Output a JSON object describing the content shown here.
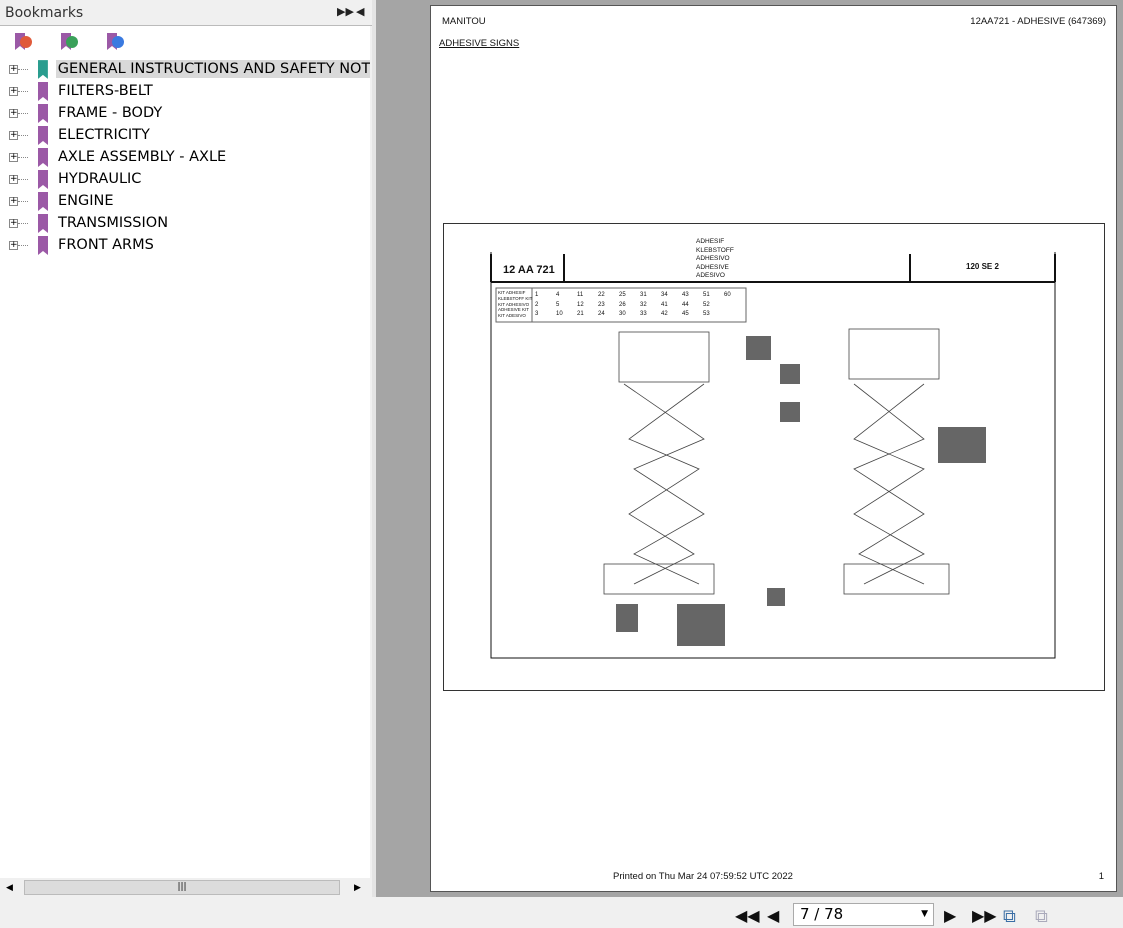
{
  "sidebar": {
    "title": "Bookmarks",
    "toolbar": [
      "delete-bookmark-icon",
      "add-bookmark-icon",
      "goto-bookmark-icon"
    ],
    "items": [
      {
        "label": "GENERAL INSTRUCTIONS AND SAFETY NOTIC",
        "selected": true,
        "color": "#2a9d8f"
      },
      {
        "label": "FILTERS-BELT",
        "color": "#9b59a6"
      },
      {
        "label": "FRAME - BODY",
        "color": "#9b59a6"
      },
      {
        "label": "ELECTRICITY",
        "color": "#9b59a6"
      },
      {
        "label": "AXLE ASSEMBLY - AXLE",
        "color": "#9b59a6"
      },
      {
        "label": "HYDRAULIC",
        "color": "#9b59a6"
      },
      {
        "label": "ENGINE",
        "color": "#9b59a6"
      },
      {
        "label": "TRANSMISSION",
        "color": "#9b59a6"
      },
      {
        "label": "FRONT ARMS",
        "color": "#9b59a6"
      }
    ]
  },
  "page": {
    "brand": "MANITOU",
    "ref": "12AA721 - ADHESIVE (647369)",
    "section": "ADHESIVE SIGNS",
    "figure": {
      "code": "12 AA 721",
      "model": "120 SE 2",
      "titles": [
        "ADHESIF",
        "KLEBSTOFF",
        "ADHESIVO",
        "ADHESIVE",
        "ADESIVO"
      ],
      "kit_label": [
        "KIT ADHESIF",
        "KLEBSTOFF KIT",
        "KIT ADHESIVO",
        "ADHESIVE KIT",
        "KIT ADESIVO"
      ],
      "kit_rows": [
        [
          "1",
          "4",
          "11",
          "22",
          "25",
          "31",
          "34",
          "43",
          "51",
          "60"
        ],
        [
          "2",
          "5",
          "12",
          "23",
          "26",
          "32",
          "41",
          "44",
          "52"
        ],
        [
          "3",
          "10",
          "21",
          "24",
          "30",
          "33",
          "42",
          "45",
          "53"
        ]
      ]
    },
    "footer": "Printed on  Thu Mar 24 07:59:52 UTC 2022",
    "number": "1"
  },
  "nav": {
    "page": "7 / 78"
  }
}
